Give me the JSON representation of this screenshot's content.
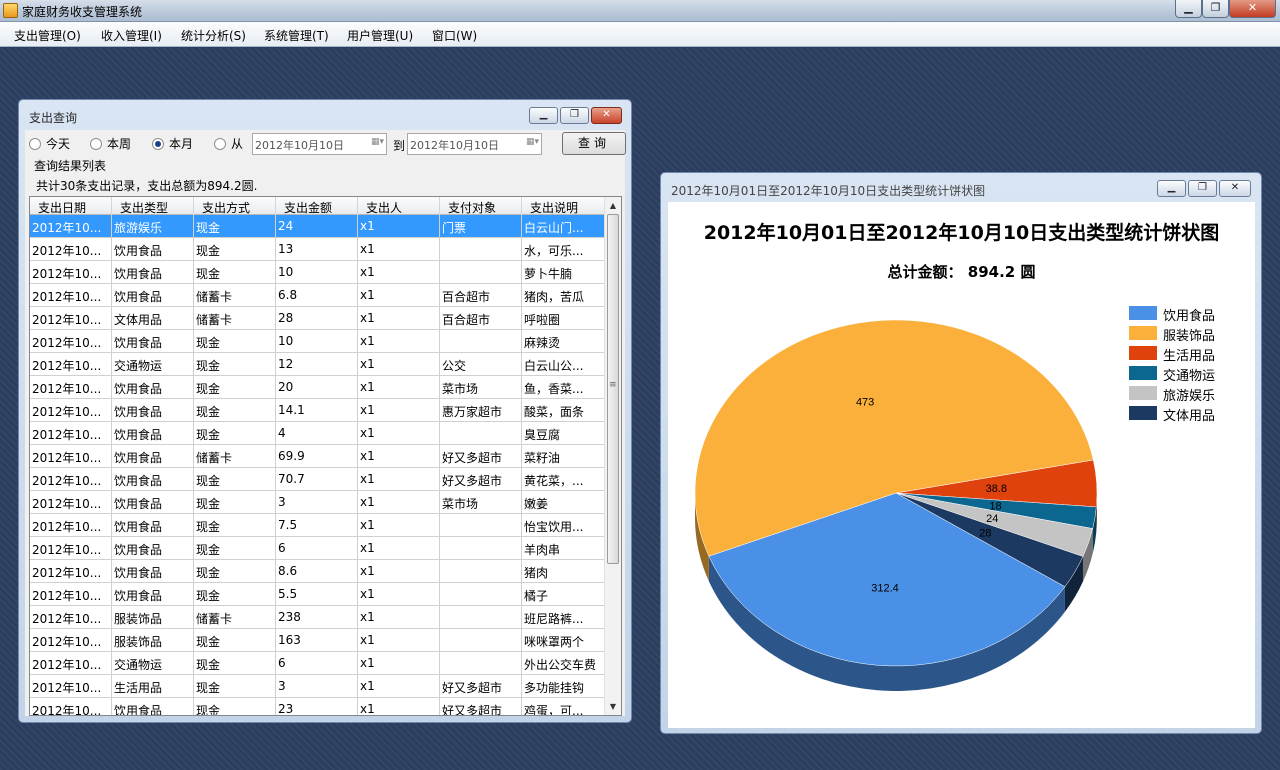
{
  "app": {
    "title": "家庭财务收支管理系统"
  },
  "menu": [
    "支出管理(O)",
    "收入管理(I)",
    "统计分析(S)",
    "系统管理(T)",
    "用户管理(U)",
    "窗口(W)"
  ],
  "query_window": {
    "title": "支出查询",
    "radios": [
      {
        "label": "今天",
        "checked": false
      },
      {
        "label": "本周",
        "checked": false
      },
      {
        "label": "本月",
        "checked": true
      },
      {
        "label": "从",
        "checked": false
      }
    ],
    "date_from": "2012年10月10日",
    "to_label": "到",
    "date_to": "2012年10月10日",
    "query_button": "查询",
    "results_label": "查询结果列表",
    "summary": "共计30条支出记录，支出总额为894.2圆.",
    "columns": [
      "支出日期",
      "支出类型",
      "支出方式",
      "支出金额",
      "支出人",
      "支付对象",
      "支出说明"
    ],
    "rows": [
      [
        "2012年10...",
        "旅游娱乐",
        "现金",
        "24",
        "x1",
        "门票",
        "白云山门..."
      ],
      [
        "2012年10...",
        "饮用食品",
        "现金",
        "13",
        "x1",
        "",
        "水，可乐..."
      ],
      [
        "2012年10...",
        "饮用食品",
        "现金",
        "10",
        "x1",
        "",
        "萝卜牛腩"
      ],
      [
        "2012年10...",
        "饮用食品",
        "储蓄卡",
        "6.8",
        "x1",
        "百合超市",
        "猪肉，苦瓜"
      ],
      [
        "2012年10...",
        "文体用品",
        "储蓄卡",
        "28",
        "x1",
        "百合超市",
        "呼啦圈"
      ],
      [
        "2012年10...",
        "饮用食品",
        "现金",
        "10",
        "x1",
        "",
        "麻辣烫"
      ],
      [
        "2012年10...",
        "交通物运",
        "现金",
        "12",
        "x1",
        "公交",
        "白云山公..."
      ],
      [
        "2012年10...",
        "饮用食品",
        "现金",
        "20",
        "x1",
        "菜市场",
        "鱼，香菜..."
      ],
      [
        "2012年10...",
        "饮用食品",
        "现金",
        "14.1",
        "x1",
        "惠万家超市",
        "酸菜，面条"
      ],
      [
        "2012年10...",
        "饮用食品",
        "现金",
        "4",
        "x1",
        "",
        "臭豆腐"
      ],
      [
        "2012年10...",
        "饮用食品",
        "储蓄卡",
        "69.9",
        "x1",
        "好又多超市",
        "菜籽油"
      ],
      [
        "2012年10...",
        "饮用食品",
        "现金",
        "70.7",
        "x1",
        "好又多超市",
        "黄花菜，..."
      ],
      [
        "2012年10...",
        "饮用食品",
        "现金",
        "3",
        "x1",
        "菜市场",
        "嫩姜"
      ],
      [
        "2012年10...",
        "饮用食品",
        "现金",
        "7.5",
        "x1",
        "",
        "怡宝饮用..."
      ],
      [
        "2012年10...",
        "饮用食品",
        "现金",
        "6",
        "x1",
        "",
        "羊肉串"
      ],
      [
        "2012年10...",
        "饮用食品",
        "现金",
        "8.6",
        "x1",
        "",
        "猪肉"
      ],
      [
        "2012年10...",
        "饮用食品",
        "现金",
        "5.5",
        "x1",
        "",
        "橘子"
      ],
      [
        "2012年10...",
        "服装饰品",
        "储蓄卡",
        "238",
        "x1",
        "",
        "班尼路裤..."
      ],
      [
        "2012年10...",
        "服装饰品",
        "现金",
        "163",
        "x1",
        "",
        "咪咪罩两个"
      ],
      [
        "2012年10...",
        "交通物运",
        "现金",
        "6",
        "x1",
        "",
        "外出公交车费"
      ],
      [
        "2012年10...",
        "生活用品",
        "现金",
        "3",
        "x1",
        "好又多超市",
        "多功能挂钩"
      ],
      [
        "2012年10...",
        "饮用食品",
        "现金",
        "23",
        "x1",
        "好又多超市",
        "鸡蛋，可..."
      ]
    ],
    "selected_row": 0
  },
  "chart_window": {
    "title": "2012年10月01日至2012年10月10日支出类型统计饼状图"
  },
  "chart_data": {
    "type": "pie",
    "title": "2012年10月01日至2012年10月10日支出类型统计饼状图",
    "subtitle": "总计金额： 894.2 圆",
    "categories": [
      "饮用食品",
      "服装饰品",
      "生活用品",
      "交通物运",
      "旅游娱乐",
      "文体用品"
    ],
    "values": [
      312.4,
      473,
      38.8,
      18,
      24,
      28
    ],
    "colors": [
      "#4a90e6",
      "#fbb03b",
      "#e0420e",
      "#0b6690",
      "#c4c4c4",
      "#1c3962"
    ],
    "legend_position": "right"
  }
}
